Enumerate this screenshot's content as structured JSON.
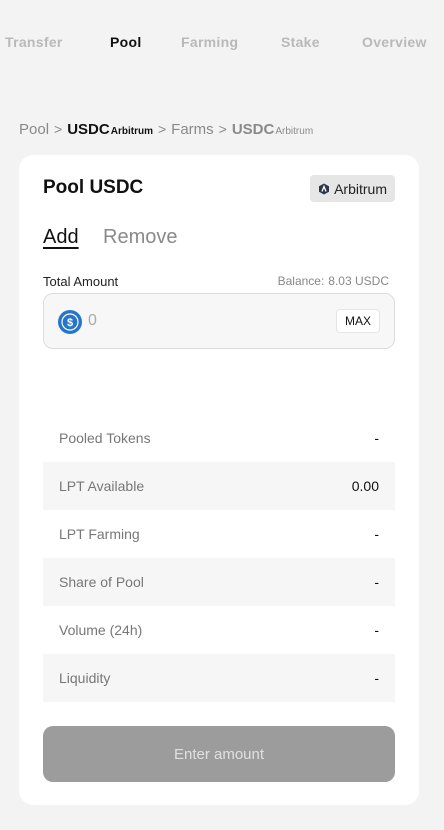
{
  "nav": {
    "transfer": "Transfer",
    "pool": "Pool",
    "farming": "Farming",
    "stake": "Stake",
    "overview": "Overview"
  },
  "breadcrumb": {
    "root": "Pool",
    "token": "USDC",
    "chain": "Arbitrum",
    "section": "Farms",
    "token2": "USDC",
    "chain2": "Arbitrum",
    "separator": ">"
  },
  "card": {
    "title": "Pool USDC",
    "chain_badge": "Arbitrum",
    "tabs": {
      "add": "Add",
      "remove": "Remove"
    },
    "total_amount_label": "Total Amount",
    "balance_label": "Balance:",
    "balance_value": "8.03 USDC",
    "amount_placeholder": "0",
    "max_label": "MAX",
    "stats": [
      {
        "label": "Pooled Tokens",
        "value": "-"
      },
      {
        "label": "LPT Available",
        "value": "0.00"
      },
      {
        "label": "LPT Farming",
        "value": "-"
      },
      {
        "label": "Share of Pool",
        "value": "-"
      },
      {
        "label": "Volume (24h)",
        "value": "-"
      },
      {
        "label": "Liquidity",
        "value": "-"
      }
    ],
    "cta_label": "Enter amount"
  },
  "colors": {
    "background": "#f3f3f3",
    "card": "#ffffff",
    "usdc_blue": "#2775ca",
    "cta_disabled": "#9c9c9c"
  },
  "icons": {
    "token": "usdc-icon",
    "chain": "arbitrum-icon"
  }
}
